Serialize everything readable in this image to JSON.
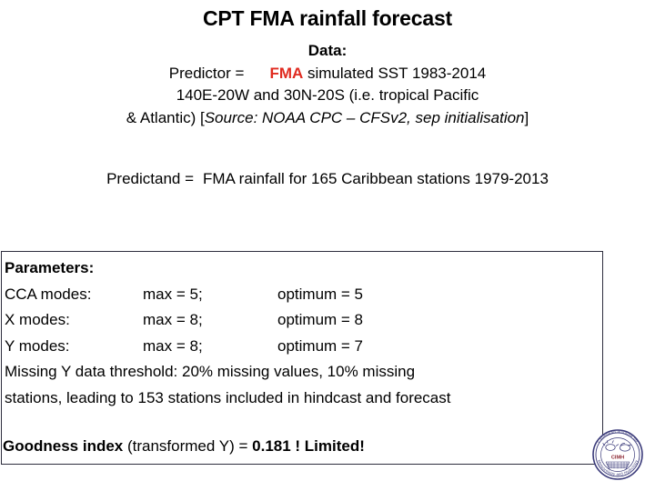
{
  "slide": {
    "title": "CPT FMA rainfall forecast"
  },
  "data_section": {
    "heading": "Data:",
    "predictor_label": "Predictor =",
    "predictor_highlight": "FMA",
    "predictor_rest": " simulated SST 1983-2014",
    "domain_line": "140E-20W and 30N-20S (i.e. tropical Pacific",
    "source_prefix": "& Atlantic) [",
    "source_italic": "Source: NOAA CPC – CFSv2, sep initialisation",
    "source_suffix": "]"
  },
  "predictand": {
    "label": "Predictand =",
    "text": "FMA rainfall  for 165 Caribbean stations 1979-2013"
  },
  "parameters": {
    "title": "Parameters:",
    "rows": [
      {
        "label": "CCA modes:",
        "max": "max = 5;",
        "optimum": "optimum = 5"
      },
      {
        "label": "X modes:",
        "max": "max = 8;",
        "optimum": "optimum = 8"
      },
      {
        "label": "Y modes:",
        "max": "max = 8;",
        "optimum": "optimum = 7"
      }
    ],
    "missing_line_1": "Missing Y data threshold: 20% missing values, 10% missing",
    "missing_line_2": "stations, leading to 153 stations included in hindcast and forecast"
  },
  "goodness": {
    "bold_label": "Goodness index",
    "plain_mid": " (transformed Y) = ",
    "bold_value": "0.181 ! Limited!"
  },
  "logo": {
    "acronym": "CIMH",
    "ring_text_top": "Caribbean Institute for",
    "ring_text_bottom": "Meteorology and Hydrology"
  },
  "colors": {
    "accent_red": "#E02B20",
    "box_border": "#2E2E3E",
    "seal_ink": "#3B3B7A",
    "text": "#000000",
    "background": "#FFFFFF"
  }
}
